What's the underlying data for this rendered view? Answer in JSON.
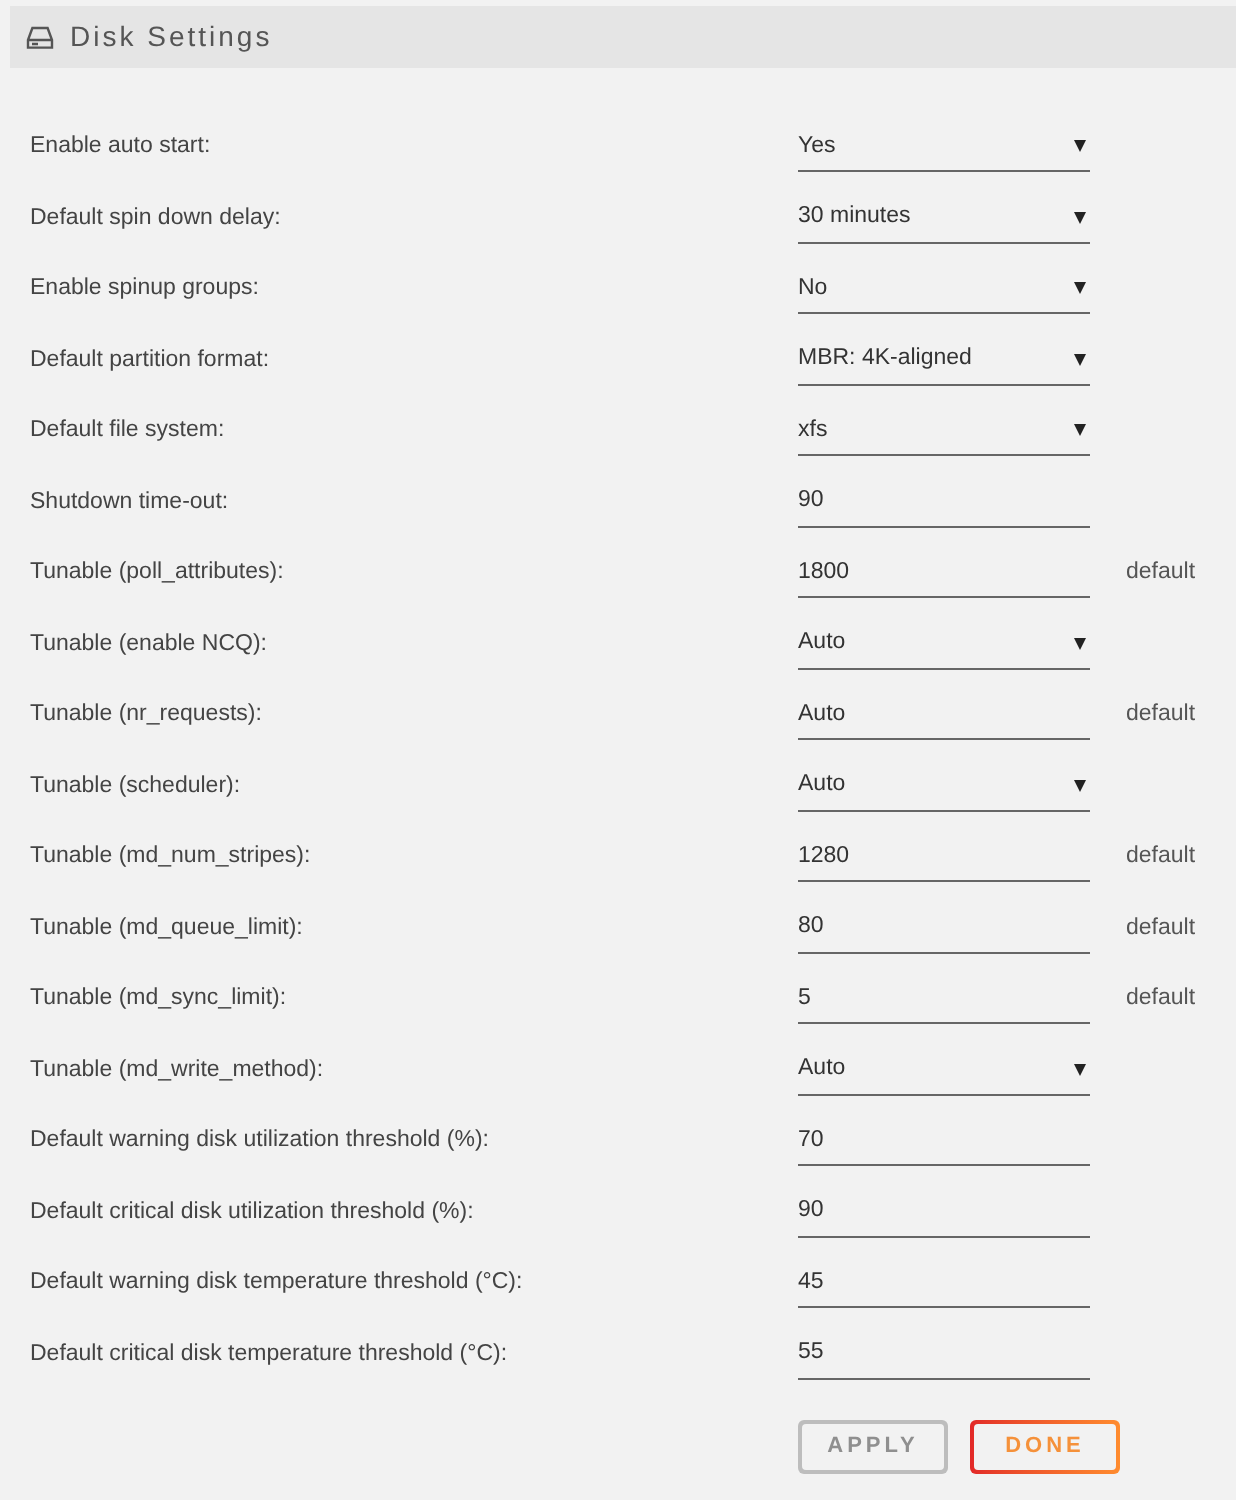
{
  "panel": {
    "title": "Disk Settings"
  },
  "settings": [
    {
      "label": "Enable auto start:",
      "kind": "select",
      "value": "Yes"
    },
    {
      "label": "Default spin down delay:",
      "kind": "select",
      "value": "30 minutes"
    },
    {
      "label": "Enable spinup groups:",
      "kind": "select",
      "value": "No"
    },
    {
      "label": "Default partition format:",
      "kind": "select",
      "value": "MBR: 4K-aligned"
    },
    {
      "label": "Default file system:",
      "kind": "select",
      "value": "xfs"
    },
    {
      "label": "Shutdown time-out:",
      "kind": "input",
      "value": "90"
    },
    {
      "label": "Tunable (poll_attributes):",
      "kind": "input",
      "value": "1800",
      "note": "default"
    },
    {
      "label": "Tunable (enable NCQ):",
      "kind": "select",
      "value": "Auto"
    },
    {
      "label": "Tunable (nr_requests):",
      "kind": "input",
      "value": "Auto",
      "note": "default"
    },
    {
      "label": "Tunable (scheduler):",
      "kind": "select",
      "value": "Auto"
    },
    {
      "label": "Tunable (md_num_stripes):",
      "kind": "input",
      "value": "1280",
      "note": "default"
    },
    {
      "label": "Tunable (md_queue_limit):",
      "kind": "input",
      "value": "80",
      "note": "default"
    },
    {
      "label": "Tunable (md_sync_limit):",
      "kind": "input",
      "value": "5",
      "note": "default"
    },
    {
      "label": "Tunable (md_write_method):",
      "kind": "select",
      "value": "Auto"
    },
    {
      "label": "Default warning disk utilization threshold (%):",
      "kind": "input",
      "value": "70"
    },
    {
      "label": "Default critical disk utilization threshold (%):",
      "kind": "input",
      "value": "90"
    },
    {
      "label": "Default warning disk temperature threshold (°C):",
      "kind": "input",
      "value": "45"
    },
    {
      "label": "Default critical disk temperature threshold (°C):",
      "kind": "input",
      "value": "55"
    }
  ],
  "buttons": [
    {
      "label": "APPLY",
      "disabled": true
    },
    {
      "label": "DONE",
      "disabled": false
    }
  ]
}
